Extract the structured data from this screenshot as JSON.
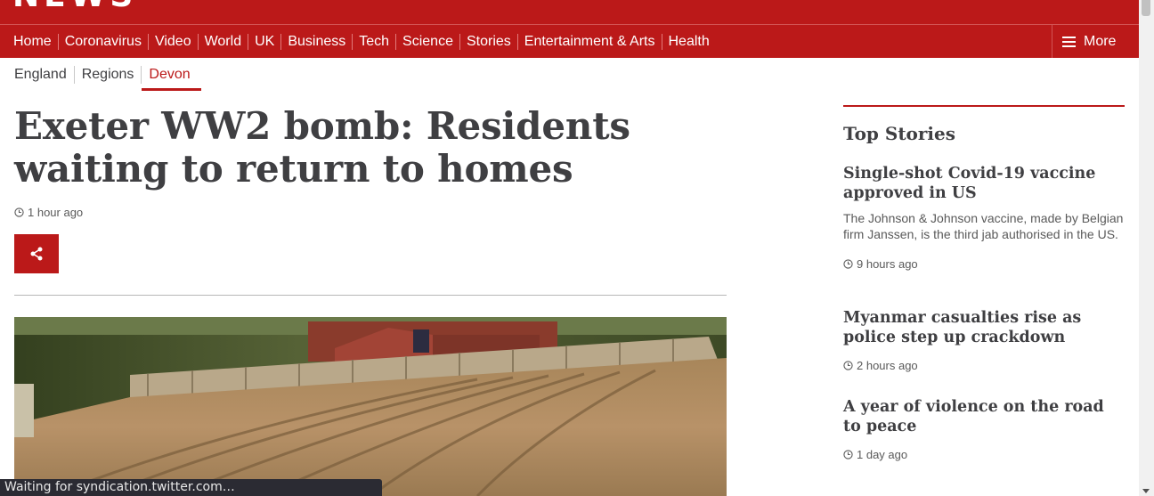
{
  "brand": {
    "logo_text": "NEWS",
    "color": "#bb1919"
  },
  "nav": {
    "items": [
      {
        "label": "Home"
      },
      {
        "label": "Coronavirus"
      },
      {
        "label": "Video"
      },
      {
        "label": "World"
      },
      {
        "label": "UK",
        "active": true
      },
      {
        "label": "Business"
      },
      {
        "label": "Tech"
      },
      {
        "label": "Science"
      },
      {
        "label": "Stories"
      },
      {
        "label": "Entertainment & Arts"
      },
      {
        "label": "Health"
      }
    ],
    "more_label": "More",
    "more_icon": "menu-icon"
  },
  "subnav": {
    "items": [
      {
        "label": "England"
      },
      {
        "label": "Regions"
      },
      {
        "label": "Devon",
        "active": true
      }
    ]
  },
  "article": {
    "headline": "Exeter WW2 bomb: Residents waiting to return to homes",
    "timestamp": "1 hour ago",
    "share_icon": "share-icon"
  },
  "sidebar": {
    "title": "Top Stories",
    "stories": [
      {
        "title": "Single-shot Covid-19 vaccine approved in US",
        "summary": "The Johnson & Johnson vaccine, made by Belgian firm Janssen, is the third jab authorised in the US.",
        "time": "9 hours ago"
      },
      {
        "title": "Myanmar casualties rise as police step up crackdown",
        "summary": "",
        "time": "2 hours ago"
      },
      {
        "title": "A year of violence on the road to peace",
        "summary": "",
        "time": "1 day ago"
      }
    ]
  },
  "status_bar": {
    "text": "Waiting for syndication.twitter.com…"
  }
}
